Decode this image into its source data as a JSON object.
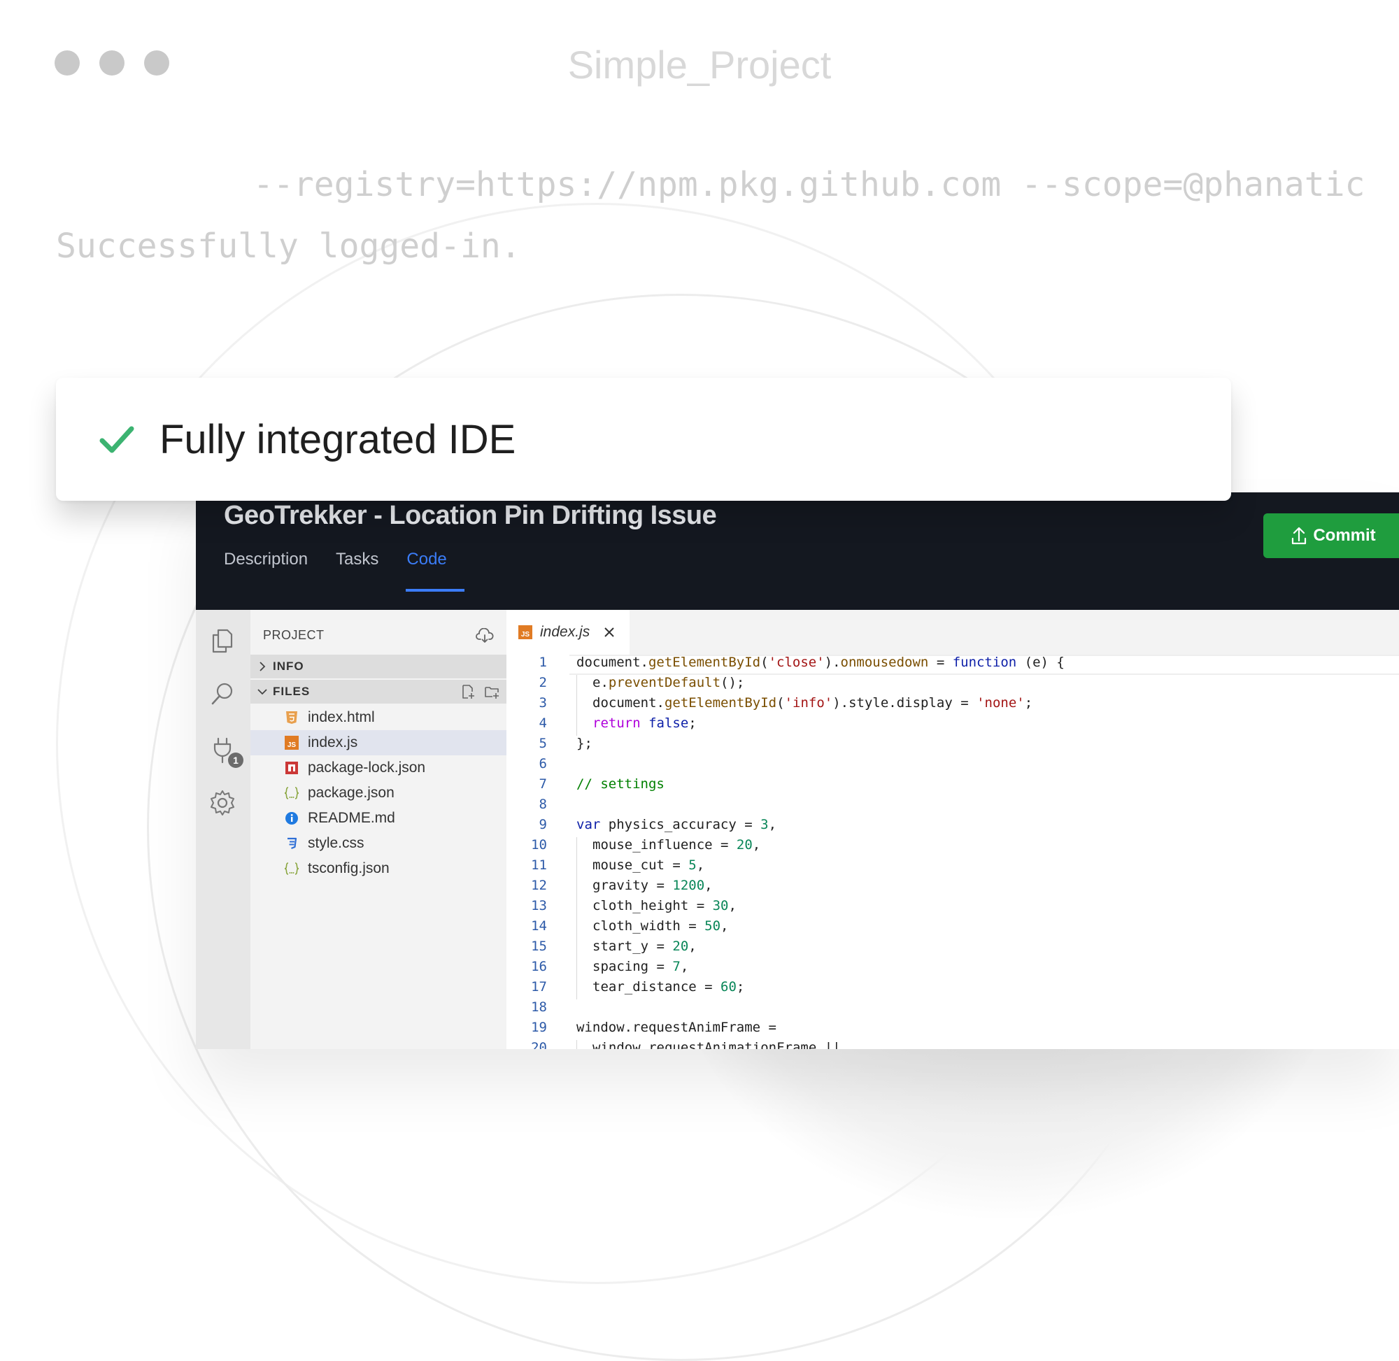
{
  "window": {
    "title": "Simple_Project"
  },
  "terminal": {
    "line1": "--registry=https://npm.pkg.github.com --scope=@phanatic",
    "line2": "Successfully logged-in."
  },
  "banner": {
    "text": "Fully integrated IDE",
    "icon": "check-icon",
    "check_color": "#3cb371"
  },
  "ide": {
    "issue_title": "GeoTrekker - Location Pin Drifting Issue",
    "tabs": [
      {
        "label": "Description",
        "active": false
      },
      {
        "label": "Tasks",
        "active": false
      },
      {
        "label": "Code",
        "active": true
      }
    ],
    "commit_label": "Commit",
    "commit_color": "#1f9d3e",
    "accent_color": "#3b7cf6",
    "activity_badge": "1",
    "explorer": {
      "title": "PROJECT",
      "sections": [
        {
          "label": "INFO",
          "expanded": false
        },
        {
          "label": "FILES",
          "expanded": true
        }
      ],
      "files": [
        {
          "name": "index.html",
          "icon": "html5-icon",
          "selected": false
        },
        {
          "name": "index.js",
          "icon": "javascript-icon",
          "selected": true
        },
        {
          "name": "package-lock.json",
          "icon": "npm-icon",
          "selected": false
        },
        {
          "name": "package.json",
          "icon": "json-braces-icon",
          "selected": false
        },
        {
          "name": "README.md",
          "icon": "info-icon",
          "selected": false
        },
        {
          "name": "style.css",
          "icon": "css3-icon",
          "selected": false
        },
        {
          "name": "tsconfig.json",
          "icon": "json-braces-icon",
          "selected": false
        }
      ]
    },
    "editor": {
      "active_tab": "index.js",
      "lines": [
        {
          "n": "1",
          "indent": 0,
          "tokens": [
            [
              "pl",
              "document."
            ],
            [
              "fn",
              "getElementById"
            ],
            [
              "pl",
              "("
            ],
            [
              "str",
              "'close'"
            ],
            [
              "pl",
              ")."
            ],
            [
              "fn",
              "onmousedown"
            ],
            [
              "pl",
              " = "
            ],
            [
              "kw",
              "function"
            ],
            [
              "pl",
              " (e) {"
            ]
          ]
        },
        {
          "n": "2",
          "indent": 1,
          "tokens": [
            [
              "pl",
              "e."
            ],
            [
              "fn",
              "preventDefault"
            ],
            [
              "pl",
              "();"
            ]
          ]
        },
        {
          "n": "3",
          "indent": 1,
          "tokens": [
            [
              "pl",
              "document."
            ],
            [
              "fn",
              "getElementById"
            ],
            [
              "pl",
              "("
            ],
            [
              "str",
              "'info'"
            ],
            [
              "pl",
              ").style.display = "
            ],
            [
              "str",
              "'none'"
            ],
            [
              "pl",
              ";"
            ]
          ]
        },
        {
          "n": "4",
          "indent": 1,
          "tokens": [
            [
              "ret",
              "return "
            ],
            [
              "kw",
              "false"
            ],
            [
              "pl",
              ";"
            ]
          ]
        },
        {
          "n": "5",
          "indent": 0,
          "tokens": [
            [
              "pl",
              "};"
            ]
          ]
        },
        {
          "n": "6",
          "indent": 0,
          "tokens": []
        },
        {
          "n": "7",
          "indent": 0,
          "tokens": [
            [
              "cm",
              "// settings"
            ]
          ]
        },
        {
          "n": "8",
          "indent": 0,
          "tokens": []
        },
        {
          "n": "9",
          "indent": 0,
          "tokens": [
            [
              "kw",
              "var "
            ],
            [
              "pl",
              "physics_accuracy = "
            ],
            [
              "num",
              "3"
            ],
            [
              "pl",
              ","
            ]
          ]
        },
        {
          "n": "10",
          "indent": 1,
          "tokens": [
            [
              "pl",
              "mouse_influence = "
            ],
            [
              "num",
              "20"
            ],
            [
              "pl",
              ","
            ]
          ]
        },
        {
          "n": "11",
          "indent": 1,
          "tokens": [
            [
              "pl",
              "mouse_cut = "
            ],
            [
              "num",
              "5"
            ],
            [
              "pl",
              ","
            ]
          ]
        },
        {
          "n": "12",
          "indent": 1,
          "tokens": [
            [
              "pl",
              "gravity = "
            ],
            [
              "num",
              "1200"
            ],
            [
              "pl",
              ","
            ]
          ]
        },
        {
          "n": "13",
          "indent": 1,
          "tokens": [
            [
              "pl",
              "cloth_height = "
            ],
            [
              "num",
              "30"
            ],
            [
              "pl",
              ","
            ]
          ]
        },
        {
          "n": "14",
          "indent": 1,
          "tokens": [
            [
              "pl",
              "cloth_width = "
            ],
            [
              "num",
              "50"
            ],
            [
              "pl",
              ","
            ]
          ]
        },
        {
          "n": "15",
          "indent": 1,
          "tokens": [
            [
              "pl",
              "start_y = "
            ],
            [
              "num",
              "20"
            ],
            [
              "pl",
              ","
            ]
          ]
        },
        {
          "n": "16",
          "indent": 1,
          "tokens": [
            [
              "pl",
              "spacing = "
            ],
            [
              "num",
              "7"
            ],
            [
              "pl",
              ","
            ]
          ]
        },
        {
          "n": "17",
          "indent": 1,
          "tokens": [
            [
              "pl",
              "tear_distance = "
            ],
            [
              "num",
              "60"
            ],
            [
              "pl",
              ";"
            ]
          ]
        },
        {
          "n": "18",
          "indent": 0,
          "tokens": []
        },
        {
          "n": "19",
          "indent": 0,
          "tokens": [
            [
              "pl",
              "window.requestAnimFrame ="
            ]
          ]
        },
        {
          "n": "20",
          "indent": 1,
          "tokens": [
            [
              "pl",
              "window.requestAnimationFrame ||"
            ]
          ]
        }
      ]
    }
  }
}
